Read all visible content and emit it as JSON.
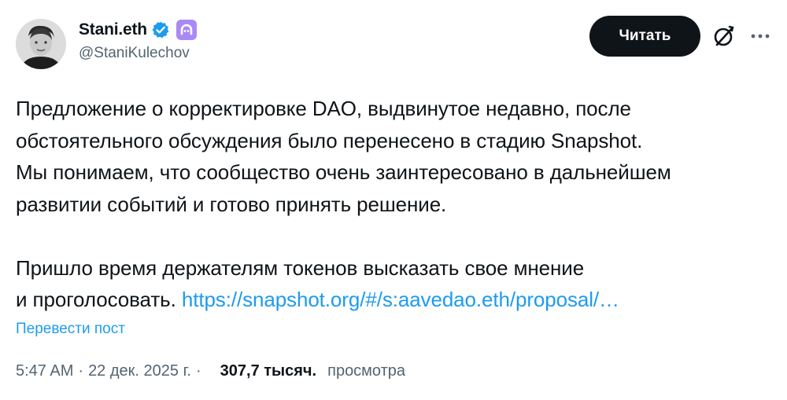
{
  "author": {
    "display_name": "Stani.eth",
    "handle": "@StaniKulechov",
    "verified_badge_color": "#1d9bf0",
    "affiliate_badge_color": "#a989f5"
  },
  "actions": {
    "follow_label": "Читать",
    "grok_icon": "grok-icon",
    "more_icon": "more-icon"
  },
  "tweet": {
    "lines_p1": [
      "Предложение о корректировке DAO, выдвинутое недавно, после",
      "обстоятельного обсуждения было перенесено в стадию Snapshot.",
      "Мы понимаем, что сообщество очень заинтересовано в дальнейшем",
      "развитии событий и готово принять решение."
    ],
    "lines_p2": [
      "Пришло время держателям токенов высказать свое мнение",
      "и проголосовать."
    ],
    "link_text": "https://snapshot.org/#/s:aavedao.eth/proposal/…",
    "translate_label": "Перевести пост"
  },
  "meta": {
    "time": "5:47 AM",
    "separator": "·",
    "date": "22 дек. 2025 г.",
    "views_count": "307,7 тысяч.",
    "views_label": "просмотра"
  },
  "colors": {
    "text_primary": "#0f1419",
    "text_secondary": "#536471",
    "link": "#1d9bf0",
    "button_bg": "#0f1419"
  }
}
